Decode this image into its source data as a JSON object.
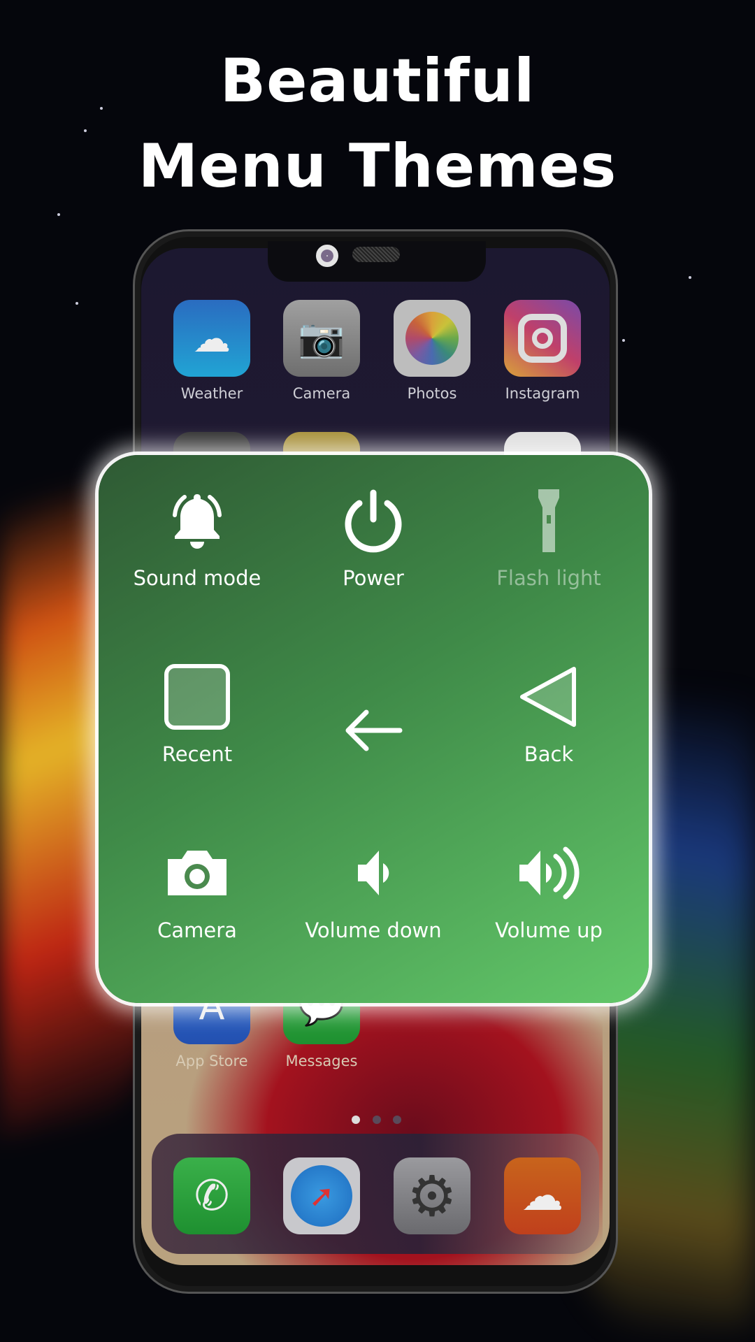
{
  "headline": {
    "line1": "Beautiful",
    "line2": "Menu Themes"
  },
  "home_screen": {
    "row1": [
      {
        "label": "Weather",
        "icon": "weather-icon"
      },
      {
        "label": "Camera",
        "icon": "camera-icon"
      },
      {
        "label": "Photos",
        "icon": "photos-icon"
      },
      {
        "label": "Instagram",
        "icon": "instagram-icon"
      }
    ],
    "row3": [
      {
        "label": "App Store",
        "icon": "app-store-icon"
      },
      {
        "label": "Messages",
        "icon": "messages-icon"
      }
    ],
    "page_dots": {
      "count": 3,
      "active": 1
    },
    "dock": [
      {
        "icon": "phone-icon"
      },
      {
        "icon": "safari-icon"
      },
      {
        "icon": "settings-icon"
      },
      {
        "icon": "soundcloud-icon"
      }
    ]
  },
  "menu": {
    "theme_color": "#4a9a52",
    "items": [
      {
        "label": "Sound mode",
        "icon": "bell-icon"
      },
      {
        "label": "Power",
        "icon": "power-icon"
      },
      {
        "label": "Flash light",
        "icon": "flashlight-icon",
        "disabled": true
      },
      {
        "label": "Recent",
        "icon": "recent-square-icon"
      },
      {
        "label": "",
        "icon": "arrow-left-icon"
      },
      {
        "label": "Back",
        "icon": "back-triangle-icon"
      },
      {
        "label": "Camera",
        "icon": "camera-icon"
      },
      {
        "label": "Volume down",
        "icon": "volume-down-icon"
      },
      {
        "label": "Volume up",
        "icon": "volume-up-icon"
      }
    ]
  }
}
